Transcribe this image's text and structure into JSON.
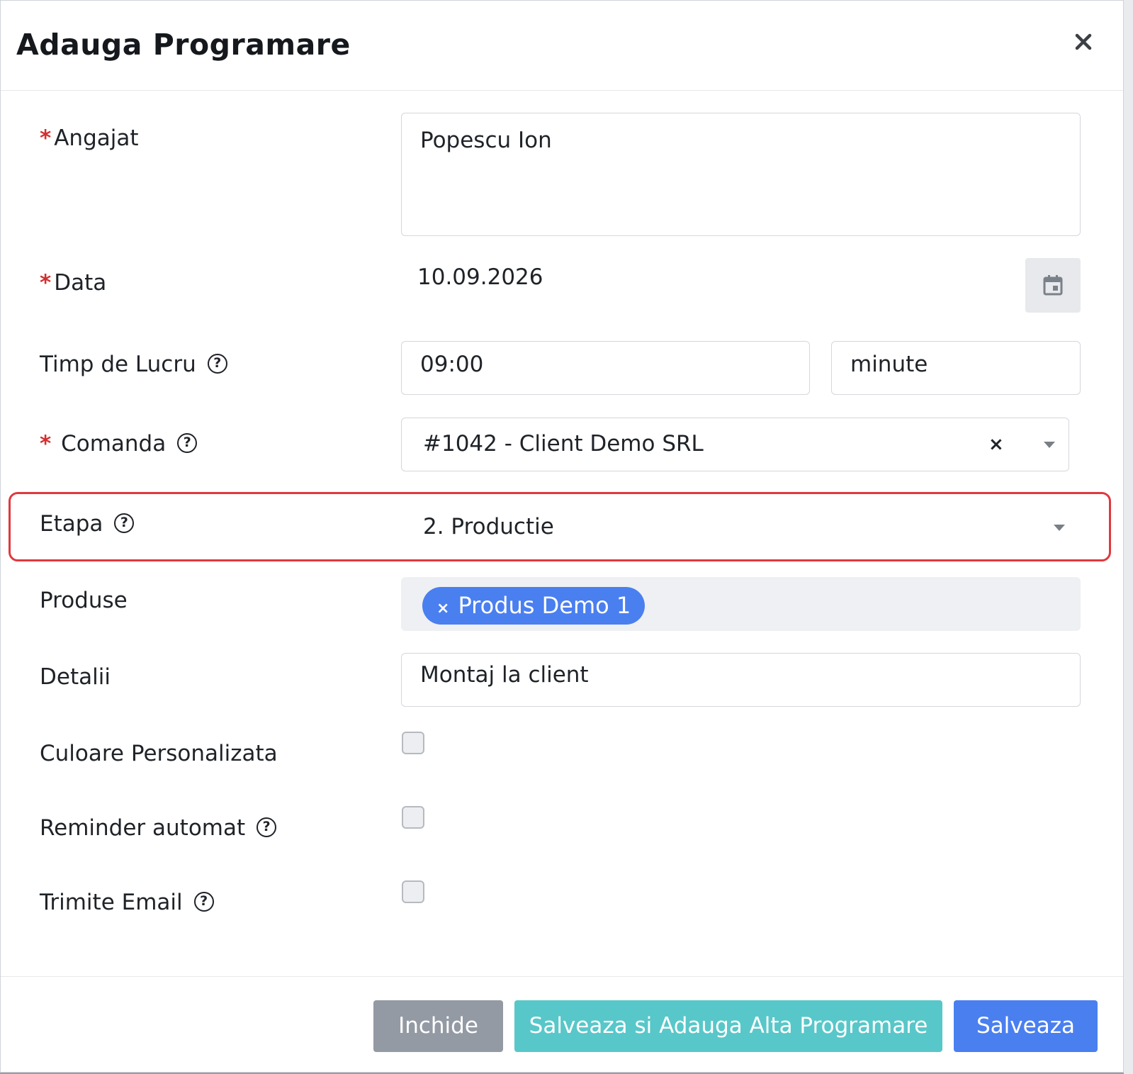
{
  "modal": {
    "title": "Adauga Programare"
  },
  "form": {
    "required_mark": "*",
    "help_glyph": "?",
    "angajat": {
      "label": "Angajat",
      "value": "Popescu Ion"
    },
    "data": {
      "label": "Data",
      "value": "10.09.2026",
      "button_icon": "calendar-icon"
    },
    "timp_de_lucru": {
      "label": "Timp de Lucru",
      "time_value": "09:00",
      "unit_value": "minute"
    },
    "comanda": {
      "label": "Comanda",
      "value": "#1042 - Client Demo SRL",
      "clear_glyph": "×"
    },
    "etapa": {
      "label": "Etapa",
      "value": "2. Productie"
    },
    "produse": {
      "label": "Produse",
      "tags": [
        {
          "label": "Produs Demo 1",
          "remove_glyph": "×"
        }
      ]
    },
    "detalii": {
      "label": "Detalii",
      "value": "Montaj la client"
    },
    "culoare_personalizata": {
      "label": "Culoare Personalizata",
      "checked": false
    },
    "reminder_automat": {
      "label": "Reminder automat",
      "checked": false
    },
    "trimite_email": {
      "label": "Trimite Email",
      "checked": false
    }
  },
  "footer": {
    "close_label": "Inchide",
    "save_add_label": "Salveaza si Adauga Alta Programare",
    "save_label": "Salveaza"
  },
  "colors": {
    "highlight": "#e0393e",
    "primary": "#4a7ff0",
    "info": "#58c7c9",
    "secondary": "#939aa4",
    "required": "#d32f2f"
  }
}
